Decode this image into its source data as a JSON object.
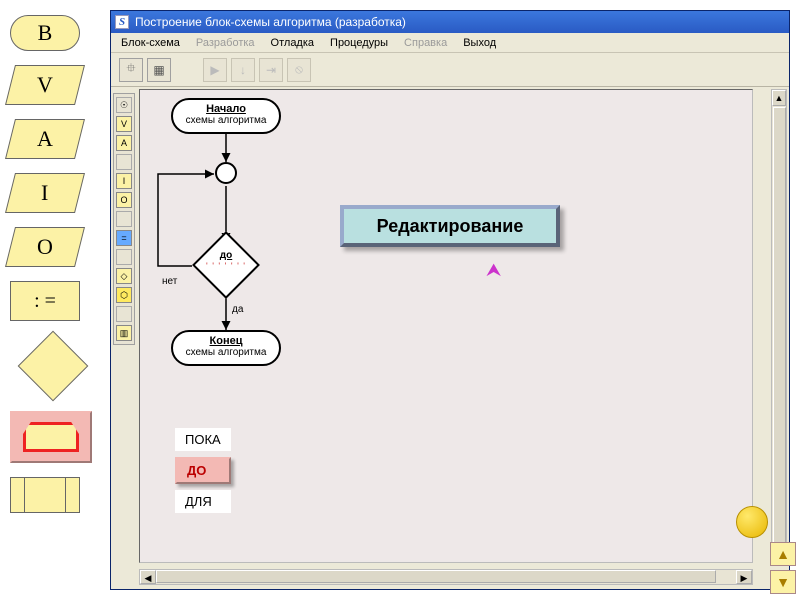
{
  "palette": {
    "B": "B",
    "V": "V",
    "A": "A",
    "I": "I",
    "O": "O",
    "eq": ": ="
  },
  "window": {
    "title": "Построение блок-схемы алгоритма (разработка)"
  },
  "menu": {
    "m1": "Блок-схема",
    "m2": "Разработка",
    "m3": "Отладка",
    "m4": "Процедуры",
    "m5": "Справка",
    "m6": "Выход"
  },
  "flow": {
    "start_b": "Начало",
    "start_t": "схемы алгоритма",
    "cond_b": "до",
    "cond_dots": "' ' ' ' ' ' '",
    "no": "нет",
    "yes": "да",
    "end_b": "Конец",
    "end_t": "схемы алгоритма"
  },
  "editbox": "Редактирование",
  "loops": {
    "l1": "ПОКА",
    "l2": "ДО",
    "l3": "ДЛЯ"
  }
}
